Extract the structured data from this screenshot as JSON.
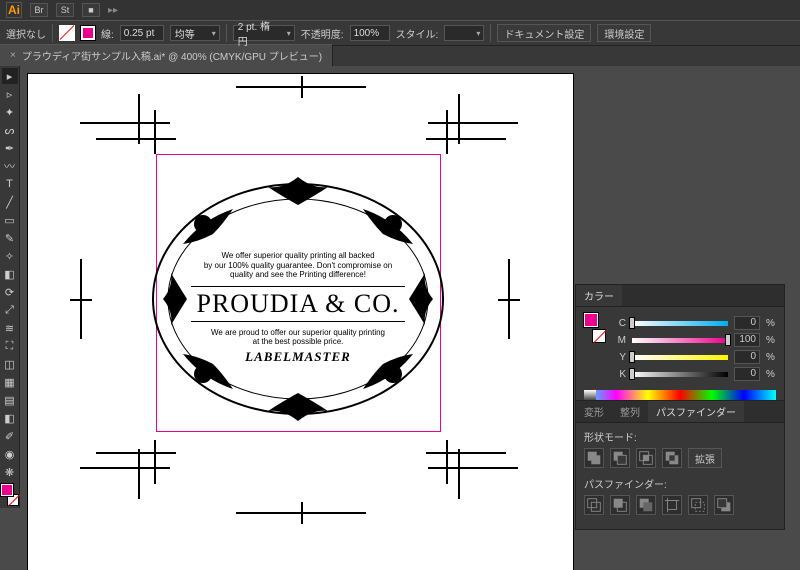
{
  "menubar": {
    "logo": "Ai",
    "tabs": [
      "Br",
      "St",
      "■"
    ]
  },
  "controlbar": {
    "selection_label": "選択なし",
    "stroke_label": "線:",
    "stroke_width": "0.25 pt",
    "profile": "均等",
    "brush_size": "2 pt. 楕円",
    "opacity_label": "不透明度:",
    "opacity_value": "100%",
    "style_label": "スタイル:",
    "doc_settings": "ドキュメント設定",
    "env_settings": "環境設定"
  },
  "doctab": {
    "title": "プラウディア街サンプル入稿.ai* @ 400% (CMYK/GPU プレビュー)"
  },
  "label": {
    "tagline1_l1": "We offer superior quality printing all backed",
    "tagline1_l2": "by our 100% quality guarantee. Don't compromise on",
    "tagline1_l3": "quality and see the Printing difference!",
    "brand": "PROUDIA & CO.",
    "tagline2_l1": "We are proud to offer our superior quality printing",
    "tagline2_l2": "at the best possible price.",
    "sub": "LABELMASTER"
  },
  "color_panel": {
    "tab": "カラー",
    "channels": [
      {
        "name": "C",
        "value": 0,
        "unit": "%"
      },
      {
        "name": "M",
        "value": 100,
        "unit": "%"
      },
      {
        "name": "Y",
        "value": 0,
        "unit": "%"
      },
      {
        "name": "K",
        "value": 0,
        "unit": "%"
      }
    ]
  },
  "pathfinder_panel": {
    "tabs": [
      "変形",
      "整列",
      "パスファインダー"
    ],
    "active_tab": 2,
    "shape_modes_label": "形状モード:",
    "expand_btn": "拡張",
    "pathfinders_label": "パスファインダー:"
  },
  "colors": {
    "accent": "#ec008c"
  }
}
